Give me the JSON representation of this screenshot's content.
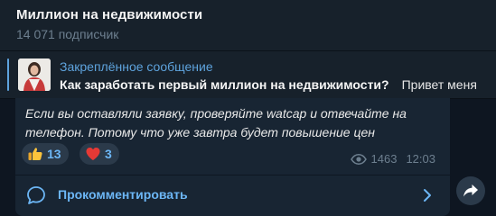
{
  "header": {
    "title": "Миллион на недвижимости",
    "subscribers": "14 071 подписчик"
  },
  "pinned": {
    "title": "Закреплённое сообщение",
    "text_bold": "Как заработать первый миллион на недвижимости?",
    "text_rest": "Привет меня"
  },
  "message": {
    "text": "Если вы оставляли заявку, проверяйте watcap и отвечайте на телефон. Потому что уже завтра будет повышение цен",
    "reactions": [
      {
        "icon": "thumbs-up",
        "count": "13"
      },
      {
        "icon": "heart",
        "count": "3"
      }
    ],
    "views": "1463",
    "time": "12:03",
    "comment_label": "Прокомментировать"
  },
  "colors": {
    "background": "#0e1621",
    "panel": "#17212b",
    "bubble": "#182533",
    "accent": "#5ea3dd",
    "link": "#6cb6f5"
  }
}
